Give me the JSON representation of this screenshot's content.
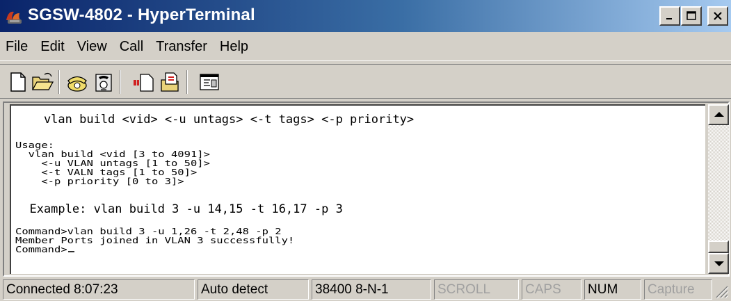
{
  "window": {
    "title": "SGSW-4802 - HyperTerminal",
    "app_icon": "hyperterminal-icon"
  },
  "title_buttons": {
    "minimize": "_",
    "maximize": "□",
    "close": "×"
  },
  "menu": [
    "File",
    "Edit",
    "View",
    "Call",
    "Transfer",
    "Help"
  ],
  "toolbar": [
    "new-connection-icon",
    "open-icon",
    "call-icon",
    "disconnect-icon",
    "send-icon",
    "receive-icon",
    "properties-icon"
  ],
  "terminal": {
    "lines": [
      "    vlan build <vid> <-u untags> <-t tags> <-p priority>",
      "Usage:",
      "  vlan build <vid [3 to 4091]>",
      "    <-u VLAN untags [1 to 50]>",
      "    <-t VALN tags [1 to 50]>",
      "    <-p priority [0 to 3]>",
      "  Example: vlan build 3 -u 14,15 -t 16,17 -p 3",
      "Command>vlan build 3 -u 1,26 -t 2,48 -p 2",
      "Member Ports joined in VLAN 3 successfully!",
      "Command>"
    ]
  },
  "status": {
    "connected": "Connected 8:07:23",
    "detect": "Auto detect",
    "settings": "38400 8-N-1",
    "scroll": "SCROLL",
    "caps": "CAPS",
    "num": "NUM",
    "capture": "Capture"
  }
}
